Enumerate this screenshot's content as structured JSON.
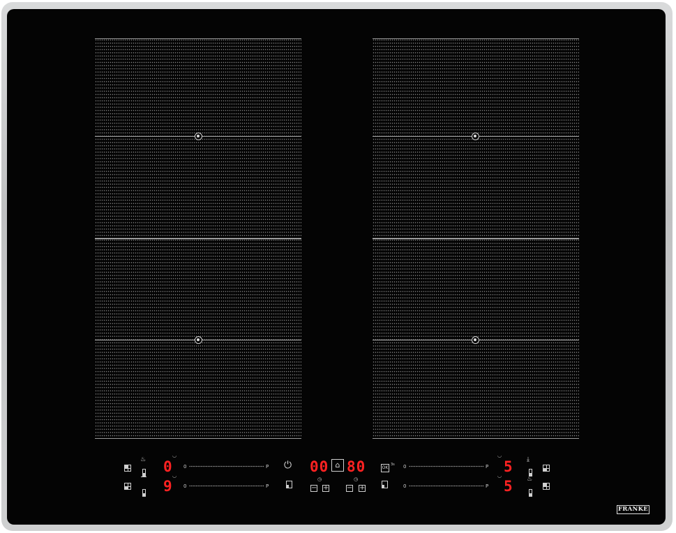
{
  "brand": "FRANKE",
  "timer": {
    "left_digits": "00",
    "right_digits": "80"
  },
  "zones": {
    "left": {
      "top_level": "0",
      "bottom_level": "9",
      "slider_min": "0",
      "slider_max": "P"
    },
    "right": {
      "top_level": "5",
      "bottom_level": "5",
      "slider_min": "0",
      "slider_max": "P"
    }
  },
  "labels": {
    "ok": "OK",
    "ok_sup": "3s"
  },
  "icons": [
    "zone-select-icon",
    "pan-icon",
    "bridge-bar-icon",
    "power-icon",
    "chef-hat-icon",
    "timer-icon",
    "minus-icon",
    "plus-icon",
    "ok-lock-icon",
    "keep-warm-icon",
    "pot-icon"
  ],
  "colors": {
    "display": "#ff2222",
    "glass": "#040404",
    "frame": "#c8c9ca"
  }
}
